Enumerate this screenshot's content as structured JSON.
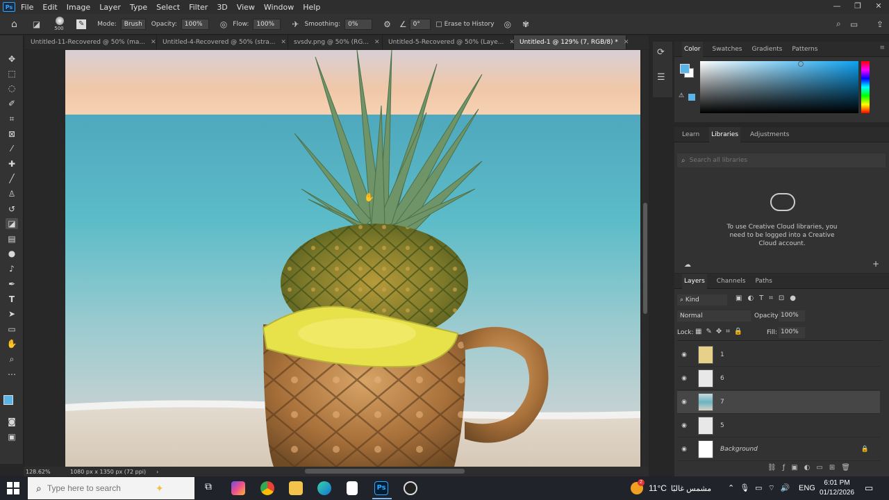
{
  "app": {
    "logo": "Ps"
  },
  "menu": [
    "File",
    "Edit",
    "Image",
    "Layer",
    "Type",
    "Select",
    "Filter",
    "3D",
    "View",
    "Window",
    "Help"
  ],
  "options": {
    "brush_size": "500",
    "mode_label": "Mode:",
    "mode_value": "Brush",
    "opacity_label": "Opacity:",
    "opacity_value": "100%",
    "flow_label": "Flow:",
    "flow_value": "100%",
    "smoothing_label": "Smoothing:",
    "smoothing_value": "0%",
    "angle_value": "0°",
    "erase_history_label": "Erase to History"
  },
  "tabs": [
    {
      "label": "Untitled-11-Recovered @ 50% (ma..."
    },
    {
      "label": "Untitled-4-Recovered @ 50% (stra..."
    },
    {
      "label": "svsdv.png @ 50% (RG..."
    },
    {
      "label": "Untitled-5-Recovered @ 50% (Laye..."
    },
    {
      "label": "Untitled-1 @ 129% (7, RGB/8) *"
    }
  ],
  "status": {
    "zoom": "128.62%",
    "doc_info": "1080 px x 1350 px (72 ppi)"
  },
  "color_panel": {
    "tabs": [
      "Color",
      "Swatches",
      "Gradients",
      "Patterns"
    ],
    "fg": "#5ab4e8",
    "bg": "#ffffff"
  },
  "libraries_panel": {
    "tabs": [
      "Learn",
      "Libraries",
      "Adjustments"
    ],
    "search_placeholder": "Search all libraries",
    "message": "To use Creative Cloud libraries, you need to be logged into a Creative Cloud account."
  },
  "layers_panel": {
    "tabs": [
      "Layers",
      "Channels",
      "Paths"
    ],
    "filter_kind": "Kind",
    "blend_mode": "Normal",
    "opacity_label": "Opacity:",
    "opacity_value": "100%",
    "lock_label": "Lock:",
    "fill_label": "Fill:",
    "fill_value": "100%",
    "layers": [
      {
        "name": "1",
        "selected": false
      },
      {
        "name": "6",
        "selected": false
      },
      {
        "name": "7",
        "selected": true
      },
      {
        "name": "5",
        "selected": false
      },
      {
        "name": "Background",
        "selected": false
      }
    ]
  },
  "taskbar": {
    "search_placeholder": "Type here to search",
    "weather": "11°C",
    "weather_desc": "مشمس غالبًا",
    "lang": "ENG",
    "time": "6:01 PM",
    "date": "01/12/2026",
    "notification_badge": "2"
  }
}
